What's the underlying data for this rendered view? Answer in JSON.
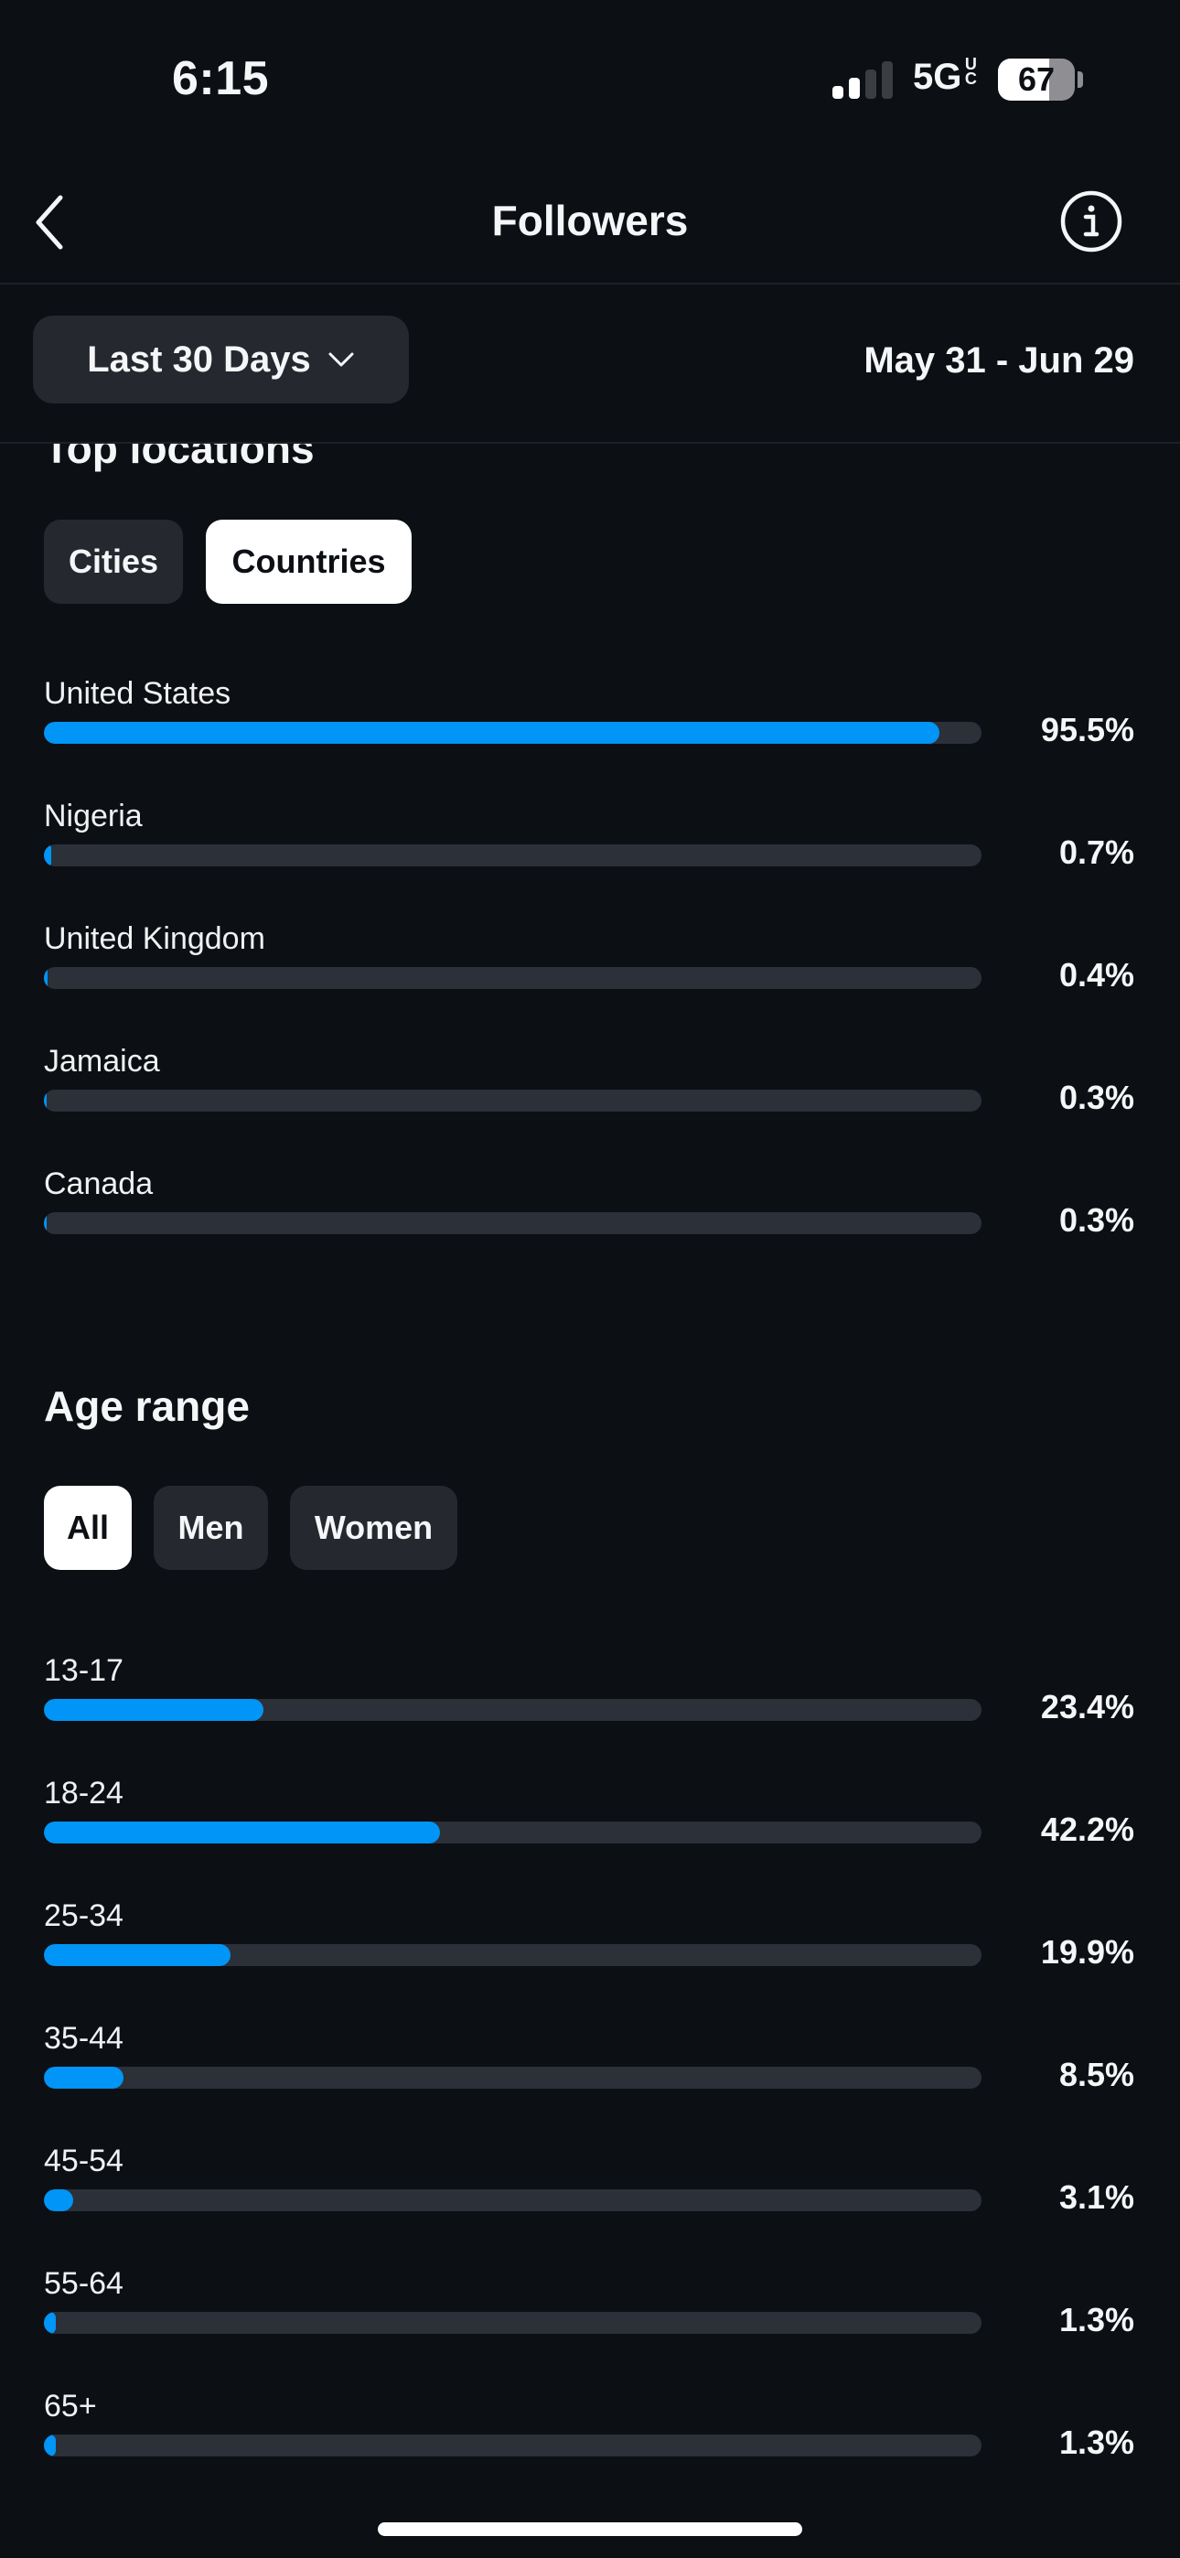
{
  "status_bar": {
    "time": "6:15",
    "signal_bars_active": 2,
    "signal_bars_total": 4,
    "network": "5G",
    "network_suffix": "UC",
    "battery_percent": 67,
    "battery_label": "67"
  },
  "nav": {
    "title": "Followers",
    "back_icon": "chevron-left-icon",
    "info_icon": "info-circle-icon"
  },
  "filter": {
    "range_label": "Last 30 Days",
    "range_icon": "chevron-down-icon",
    "date_range": "May 31 - Jun 29"
  },
  "colors": {
    "background": "#0c0f14",
    "accent_bar": "#0095f6",
    "track": "#2c3038",
    "pill_inactive": "#25282e",
    "pill_active": "#ffffff"
  },
  "top_locations": {
    "title": "Top locations",
    "tabs": [
      {
        "label": "Cities",
        "active": false
      },
      {
        "label": "Countries",
        "active": true
      }
    ],
    "items": [
      {
        "label": "United States",
        "value": 95.5,
        "display": "95.5%"
      },
      {
        "label": "Nigeria",
        "value": 0.7,
        "display": "0.7%"
      },
      {
        "label": "United Kingdom",
        "value": 0.4,
        "display": "0.4%"
      },
      {
        "label": "Jamaica",
        "value": 0.3,
        "display": "0.3%"
      },
      {
        "label": "Canada",
        "value": 0.3,
        "display": "0.3%"
      }
    ]
  },
  "age_range": {
    "title": "Age range",
    "tabs": [
      {
        "label": "All",
        "active": true
      },
      {
        "label": "Men",
        "active": false
      },
      {
        "label": "Women",
        "active": false
      }
    ],
    "items": [
      {
        "label": "13-17",
        "value": 23.4,
        "display": "23.4%"
      },
      {
        "label": "18-24",
        "value": 42.2,
        "display": "42.2%"
      },
      {
        "label": "25-34",
        "value": 19.9,
        "display": "19.9%"
      },
      {
        "label": "35-44",
        "value": 8.5,
        "display": "8.5%"
      },
      {
        "label": "45-54",
        "value": 3.1,
        "display": "3.1%"
      },
      {
        "label": "55-64",
        "value": 1.3,
        "display": "1.3%"
      },
      {
        "label": "65+",
        "value": 1.3,
        "display": "1.3%"
      }
    ]
  },
  "chart_data": [
    {
      "type": "bar",
      "orientation": "horizontal",
      "title": "Top locations",
      "categories": [
        "United States",
        "Nigeria",
        "United Kingdom",
        "Jamaica",
        "Canada"
      ],
      "values": [
        95.5,
        0.7,
        0.4,
        0.3,
        0.3
      ],
      "unit": "%",
      "xlim": [
        0,
        100
      ]
    },
    {
      "type": "bar",
      "orientation": "horizontal",
      "title": "Age range",
      "categories": [
        "13-17",
        "18-24",
        "25-34",
        "35-44",
        "45-54",
        "55-64",
        "65+"
      ],
      "values": [
        23.4,
        42.2,
        19.9,
        8.5,
        3.1,
        1.3,
        1.3
      ],
      "unit": "%",
      "xlim": [
        0,
        100
      ]
    }
  ]
}
